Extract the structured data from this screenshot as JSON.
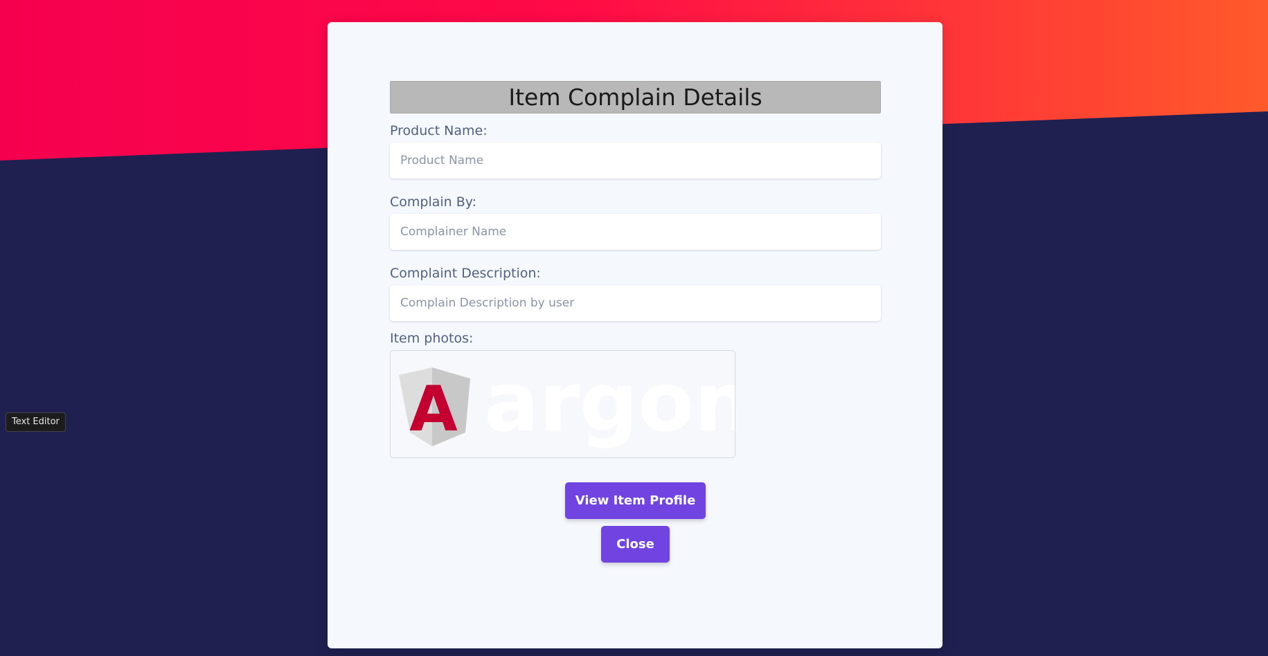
{
  "tooltip": {
    "text": "Text Editor"
  },
  "modal": {
    "title": "Item Complain Details",
    "fields": [
      {
        "label": "Product Name:",
        "placeholder": "Product Name",
        "value": ""
      },
      {
        "label": "Complain By:",
        "placeholder": "Complainer Name",
        "value": ""
      },
      {
        "label": "Complaint Description:",
        "placeholder": "Complain Description by user",
        "value": ""
      }
    ],
    "photos_label": "Item photos:",
    "photo": {
      "logo_letter": "A",
      "logo_word": "argon",
      "icon": "angular-logo-icon"
    },
    "buttons": {
      "view_profile": "View Item Profile",
      "close": "Close"
    }
  },
  "colors": {
    "background_dark": "#1f2050",
    "gradient_start": "#f5004f",
    "gradient_end": "#ff5a2b",
    "modal_bg": "#f5f8fc",
    "title_bar": "#b8b8b8",
    "button_primary": "#7144e2",
    "angular_red": "#c3002f"
  }
}
